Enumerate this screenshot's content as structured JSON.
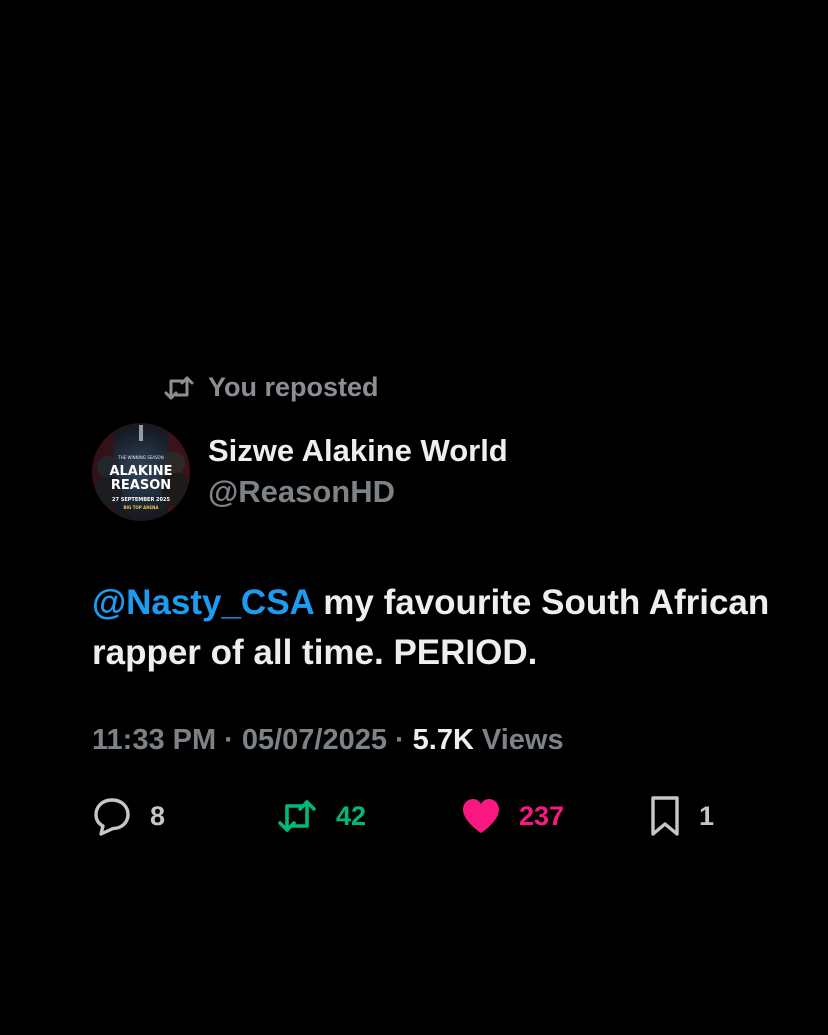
{
  "repost_banner": {
    "icon": "repost-icon",
    "label": "You reposted"
  },
  "author": {
    "avatar": {
      "top_text": "THE WINNING SEASON",
      "title_line1": "ALAKINE",
      "title_line2": "REASON",
      "date_line": "27 SEPTEMBER 2025",
      "venue_line": "BIG TOP ARENA"
    },
    "display_name": "Sizwe Alakine World",
    "handle": "@ReasonHD"
  },
  "tweet": {
    "mention": "@Nasty_CSA",
    "text_line1_rest": " my favourite South African",
    "text_line2": "rapper of all time. PERIOD."
  },
  "meta": {
    "time": "11:33 PM",
    "separator": "·",
    "date": "05/07/2025",
    "views_count": "5.7K",
    "views_label": "Views"
  },
  "actions": {
    "reply": {
      "icon": "reply-bubble-icon",
      "count": "8"
    },
    "retweet": {
      "icon": "retweet-icon",
      "count": "42",
      "color": "#00ba7c"
    },
    "like": {
      "icon": "heart-icon",
      "count": "237",
      "color": "#f91880"
    },
    "bookmark": {
      "icon": "bookmark-icon",
      "count": "1"
    }
  },
  "colors": {
    "background": "#000000",
    "mention": "#1d9bf0",
    "muted": "#7d8287"
  }
}
